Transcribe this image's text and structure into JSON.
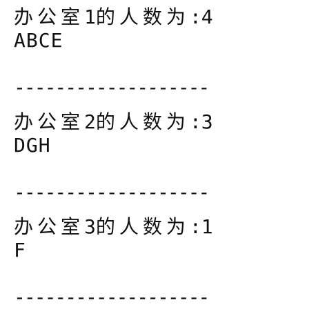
{
  "offices": [
    {
      "label": "办公室",
      "number": "1",
      "suffix": "的人数为",
      "colon": ":",
      "count": "4",
      "members": "ABCE",
      "separator": "-------------------"
    },
    {
      "label": "办公室",
      "number": "2",
      "suffix": "的人数为",
      "colon": ":",
      "count": "3",
      "members": "DGH",
      "separator": "-------------------"
    },
    {
      "label": "办公室",
      "number": "3",
      "suffix": "的人数为",
      "colon": ":",
      "count": "1",
      "members": "F",
      "separator": "-------------------"
    }
  ]
}
